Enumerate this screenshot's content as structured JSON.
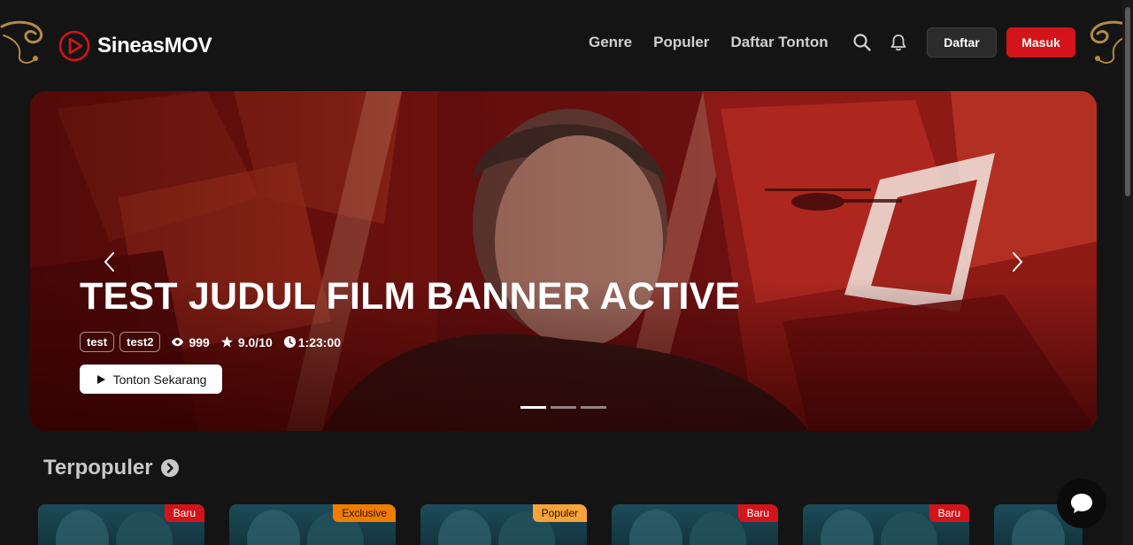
{
  "brand": {
    "name": "SineasMOV",
    "accent": "#d3141a"
  },
  "nav": {
    "items": [
      "Genre",
      "Populer",
      "Daftar Tonton"
    ]
  },
  "header": {
    "register_label": "Daftar",
    "login_label": "Masuk"
  },
  "banner": {
    "title": "TEST JUDUL FILM BANNER ACTIVE",
    "tags": [
      "test",
      "test2"
    ],
    "views": "999",
    "rating": "9.0/10",
    "duration": "1:23:00",
    "watch_label": "Tonton Sekarang",
    "slides": 3,
    "active_slide": 1
  },
  "section": {
    "title": "Terpopuler"
  },
  "cards": [
    {
      "badge": "Baru",
      "badge_color": "#d3141a"
    },
    {
      "badge": "Exclusive",
      "badge_color": "#f07c00"
    },
    {
      "badge": "Populer",
      "badge_color": "#f6a33a"
    },
    {
      "badge": "Baru",
      "badge_color": "#d3141a"
    },
    {
      "badge": "Baru",
      "badge_color": "#d3141a"
    },
    {
      "badge": "",
      "badge_color": ""
    }
  ]
}
